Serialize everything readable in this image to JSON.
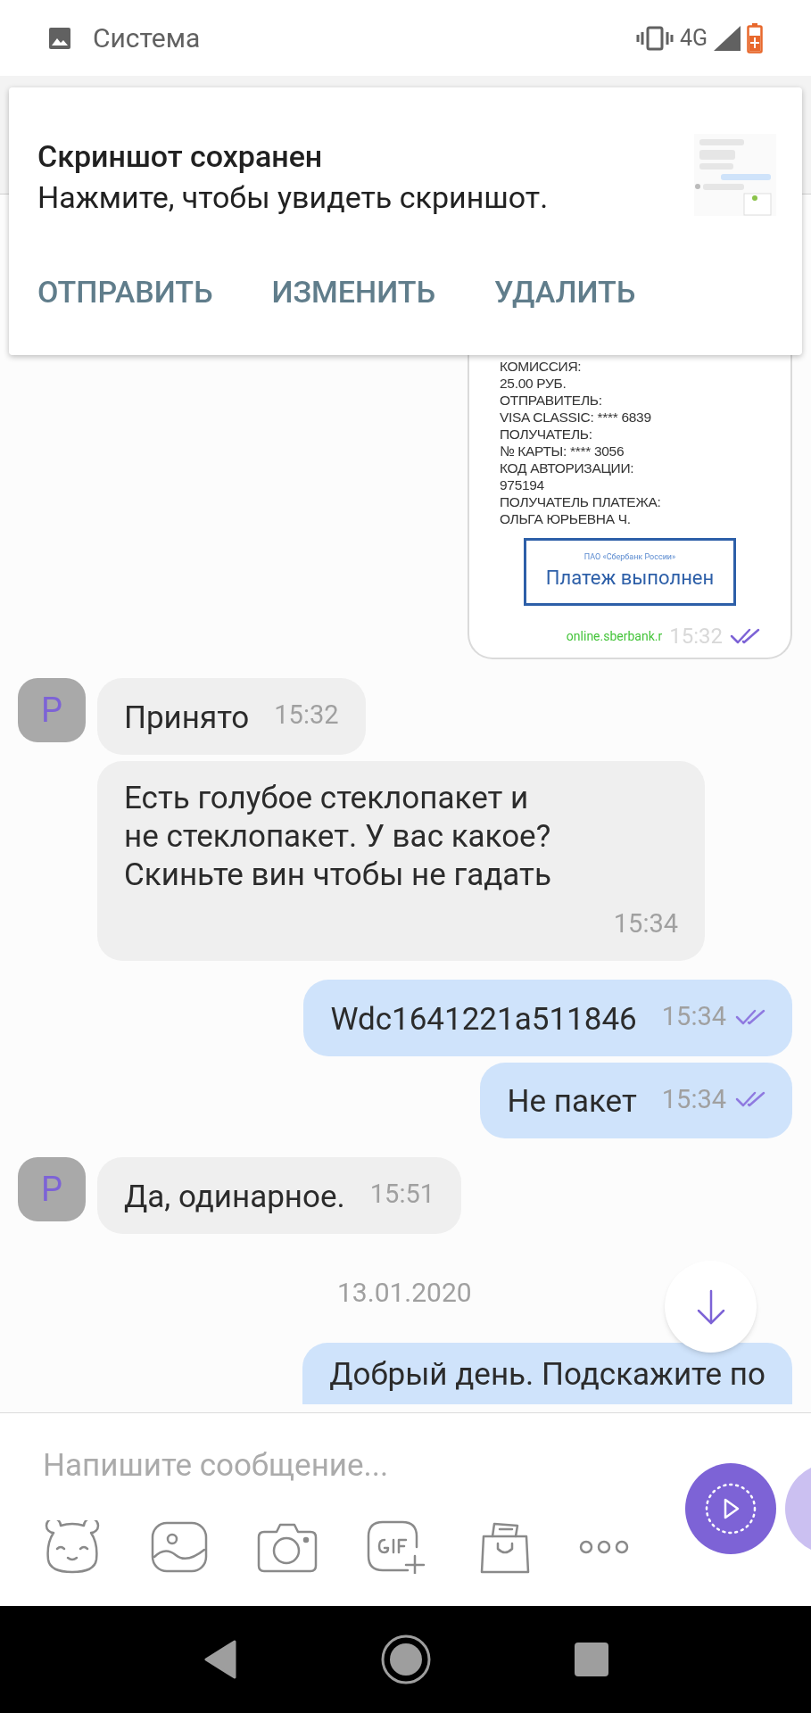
{
  "status_bar": {
    "app_label": "Система",
    "network": "4G"
  },
  "notification": {
    "title": "Скриншот сохранен",
    "text": "Нажмите, чтобы увидеть скриншот.",
    "actions": [
      "ОТПРАВИТЬ",
      "ИЗМЕНИТЬ",
      "УДАЛИТЬ"
    ]
  },
  "receipt_message": {
    "lines": [
      "КОМИССИЯ:",
      "25.00 РУБ.",
      "ОТПРАВИТЕЛЬ:",
      "VISA CLASSIC: **** 6839",
      "ПОЛУЧАТЕЛЬ:",
      "№ КАРТЫ: **** 3056",
      "КОД АВТОРИЗАЦИИ:",
      "975194",
      "ПОЛУЧАТЕЛЬ ПЛАТЕЖА:",
      "ОЛЬГА ЮРЬЕВНА Ч."
    ],
    "stamp_bank": "ПАО «Сбербанк России»",
    "stamp_text": "Платеж выполнен",
    "source": "online.sberbank.r",
    "time": "15:32",
    "read": true
  },
  "thread": [
    {
      "kind": "incoming",
      "avatar": "P",
      "text": "Принято",
      "time": "15:32"
    },
    {
      "kind": "incoming",
      "text": "Есть голубое стеклопакет и\nне стеклопакет. У вас какое?\nСкиньте вин чтобы не гадать",
      "time": "15:34"
    },
    {
      "kind": "outgoing",
      "text": "Wdc1641221a511846",
      "time": "15:34",
      "read": true
    },
    {
      "kind": "outgoing",
      "text": "Не пакет",
      "time": "15:34",
      "read": true
    },
    {
      "kind": "incoming",
      "avatar": "P",
      "text": "Да, одинарное.",
      "time": "15:51"
    },
    {
      "kind": "date",
      "text": "13.01.2020"
    },
    {
      "kind": "outgoing",
      "text": "Добрый день. Подскажите по"
    }
  ],
  "composer": {
    "placeholder": "Напишите сообщение..."
  }
}
